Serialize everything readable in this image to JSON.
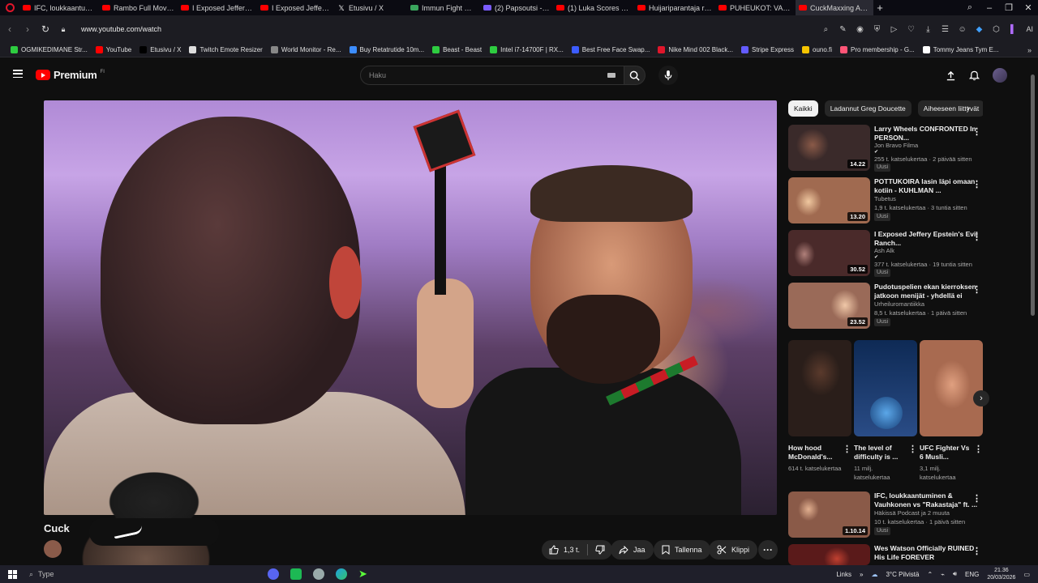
{
  "browser": {
    "tabs": [
      {
        "label": "IFC, loukkaantuminen",
        "icon": "youtube-icon"
      },
      {
        "label": "Rambo Full Movie Eng",
        "icon": "youtube-icon"
      },
      {
        "label": "I Exposed Jeffery Epst",
        "icon": "youtube-icon"
      },
      {
        "label": "I Exposed Jeffery Epst",
        "icon": "youtube-icon"
      },
      {
        "label": "Etusivu / X",
        "icon": "x-icon"
      },
      {
        "label": "Immun Fight Club | R",
        "icon": "green-icon"
      },
      {
        "label": "(2) Papsoutsi - Afro S",
        "icon": "purple-icon"
      },
      {
        "label": "(1) Luka Scores First L",
        "icon": "youtube-icon"
      },
      {
        "label": "Huijariparantaja raivo",
        "icon": "youtube-icon"
      },
      {
        "label": "PUHEUKOT: VARTTI IS",
        "icon": "youtube-icon"
      },
      {
        "label": "CuckMaxxing Adam22 V",
        "icon": "youtube-icon",
        "active": true
      }
    ],
    "url": "www.youtube.com/watch",
    "ai_label": "AI",
    "bookmarks": [
      {
        "label": "OGMIKEDIMANE Str...",
        "color": "#2ecc40"
      },
      {
        "label": "YouTube",
        "color": "#ff0000"
      },
      {
        "label": "Etusivu / X",
        "color": "#000000"
      },
      {
        "label": "Twitch Emote Resizer",
        "color": "#dddddd"
      },
      {
        "label": "World Monitor - Re...",
        "color": "#888888"
      },
      {
        "label": "Buy Retatrutide 10m...",
        "color": "#3c8dff"
      },
      {
        "label": "Beast - Beast",
        "color": "#2ecc40"
      },
      {
        "label": "Intel i7-14700F | RX...",
        "color": "#2ecc40"
      },
      {
        "label": "Best Free Face Swap...",
        "color": "#3c5cff"
      },
      {
        "label": "Nike Mind 002 Black...",
        "color": "#e0162b"
      },
      {
        "label": "Stripe Express",
        "color": "#635bff"
      },
      {
        "label": "ouno.fi",
        "color": "#f5c400"
      },
      {
        "label": "Pro membership - G...",
        "color": "#ff5577"
      },
      {
        "label": "Tommy Jeans Tym E...",
        "color": "#ffffff"
      }
    ]
  },
  "youtube": {
    "logo_text": "Premium",
    "logo_sup": "FI",
    "search_placeholder": "Haku",
    "video_title": "Cuck",
    "actions": {
      "likes": "1,3 t.",
      "share": "Jaa",
      "save": "Tallenna",
      "clip": "Klippi"
    },
    "chips": [
      "Kaikki",
      "Ladannut Greg Doucette",
      "Aiheeseen liittyvät"
    ],
    "recommendations": [
      {
        "title": "Larry Wheels CONFRONTED In PERSON...",
        "channel": "Jon Bravo Filma",
        "verified": true,
        "meta": "255 t. katselukertaa · 2 päivää sitten",
        "badge": "Uusi",
        "duration": "14.22"
      },
      {
        "title": "POTTUKOIRA lasin läpi omaan kotiin - KUHLMAN ...",
        "channel": "Tubetus",
        "verified": false,
        "meta": "1,9 t. katselukertaa · 3 tuntia sitten",
        "badge": "Uusi",
        "duration": "13.20"
      },
      {
        "title": "I Exposed Jeffery Epstein's Evil Ranch...",
        "channel": "Ash Alk",
        "verified": true,
        "meta": "377 t. katselukertaa · 19 tuntia sitten",
        "badge": "Uusi",
        "duration": "30.52"
      },
      {
        "title": "Pudotuspelien ekan kierroksen jatkoon menijät - yhdellä ei riit...",
        "channel": "Urheiluromantiikka",
        "verified": false,
        "meta": "8,5 t. katselukertaa · 1 päivä sitten",
        "badge": "Uusi",
        "duration": "23.52"
      }
    ],
    "shorts": [
      {
        "title": "How hood McDonald's...",
        "views": "614 t. katselukertaa"
      },
      {
        "title": "The level of difficulty is ...",
        "views": "11 milj. katselukertaa"
      },
      {
        "title": "UFC Fighter Vs 6 Musli...",
        "views": "3,1 milj. katselukertaa"
      }
    ],
    "more_recs": [
      {
        "title": "IFC, loukkaantuminen & Vauhkonen vs \"Rakastaja\" ft. ...",
        "channel": "Häkissä Podcast ja 2 muuta",
        "meta": "10 t. katselukertaa · 1 päivä sitten",
        "badge": "Uusi",
        "duration": "1.10.14"
      },
      {
        "title": "Wes Watson Officially RUINED His Life FOREVER",
        "channel": "",
        "meta": "",
        "badge": "",
        "duration": ""
      }
    ]
  },
  "taskbar": {
    "search_label": "Type",
    "links_label": "Links",
    "weather": "3°C  Pilvistä",
    "lang": "ENG",
    "time": "21.36",
    "date": "20/03/2026"
  }
}
